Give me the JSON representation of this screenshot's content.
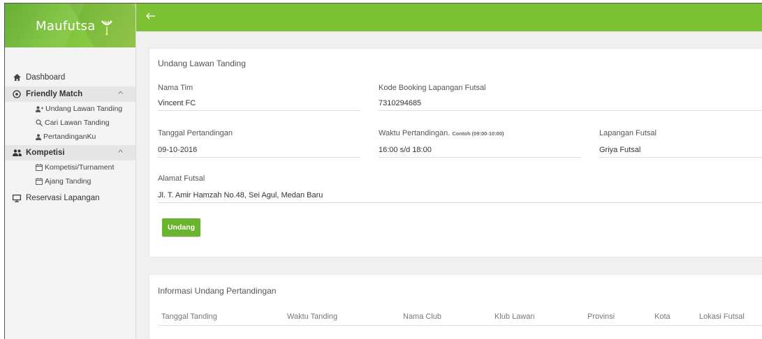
{
  "brand": {
    "name": "Maufutsa",
    "logo_icon": "lime-fork-icon"
  },
  "colors": {
    "topbar": "#7cc134",
    "button": "#6ab42f",
    "sidebar_bg": "#f4f4f4"
  },
  "sidebar": {
    "dashboard": "Dashboard",
    "friendly_match": "Friendly Match",
    "undang_lawan": "Undang Lawan Tanding",
    "cari_lawan": "Cari Lawan Tanding",
    "pertandinganku": "PertandinganKu",
    "kompetisi": "Kompetisi",
    "kompetisi_turnament": "Kompetisi/Turnament",
    "ajang_tanding": "Ajang Tanding",
    "reservasi": "Reservasi Lapangan"
  },
  "form": {
    "title": "Undang Lawan Tanding",
    "nama_tim_label": "Nama Tim",
    "nama_tim_value": "Vincent FC",
    "kode_booking_label": "Kode Booking Lapangan Futsal",
    "kode_booking_value": "7310294685",
    "tanggal_label": "Tanggal Pertandingan",
    "tanggal_value": "09-10-2016",
    "waktu_label": "Waktu Pertandingan.",
    "waktu_hint": "Contoh (09:00-10:00)",
    "waktu_value": "16:00 s/d 18:00",
    "lapangan_label": "Lapangan Futsal",
    "lapangan_value": "Griya Futsal",
    "alamat_label": "Alamat Futsal",
    "alamat_value": "Jl. T. Amir Hamzah No.48, Sei Agul, Medan Baru",
    "submit_label": "Undang"
  },
  "info": {
    "title": "Informasi Undang Pertandingan",
    "columns": [
      "Tanggal Tanding",
      "Waktu Tanding",
      "Nama Club",
      "Klub Lawan",
      "Provinsi",
      "Kota",
      "Lokasi Futsal"
    ]
  }
}
